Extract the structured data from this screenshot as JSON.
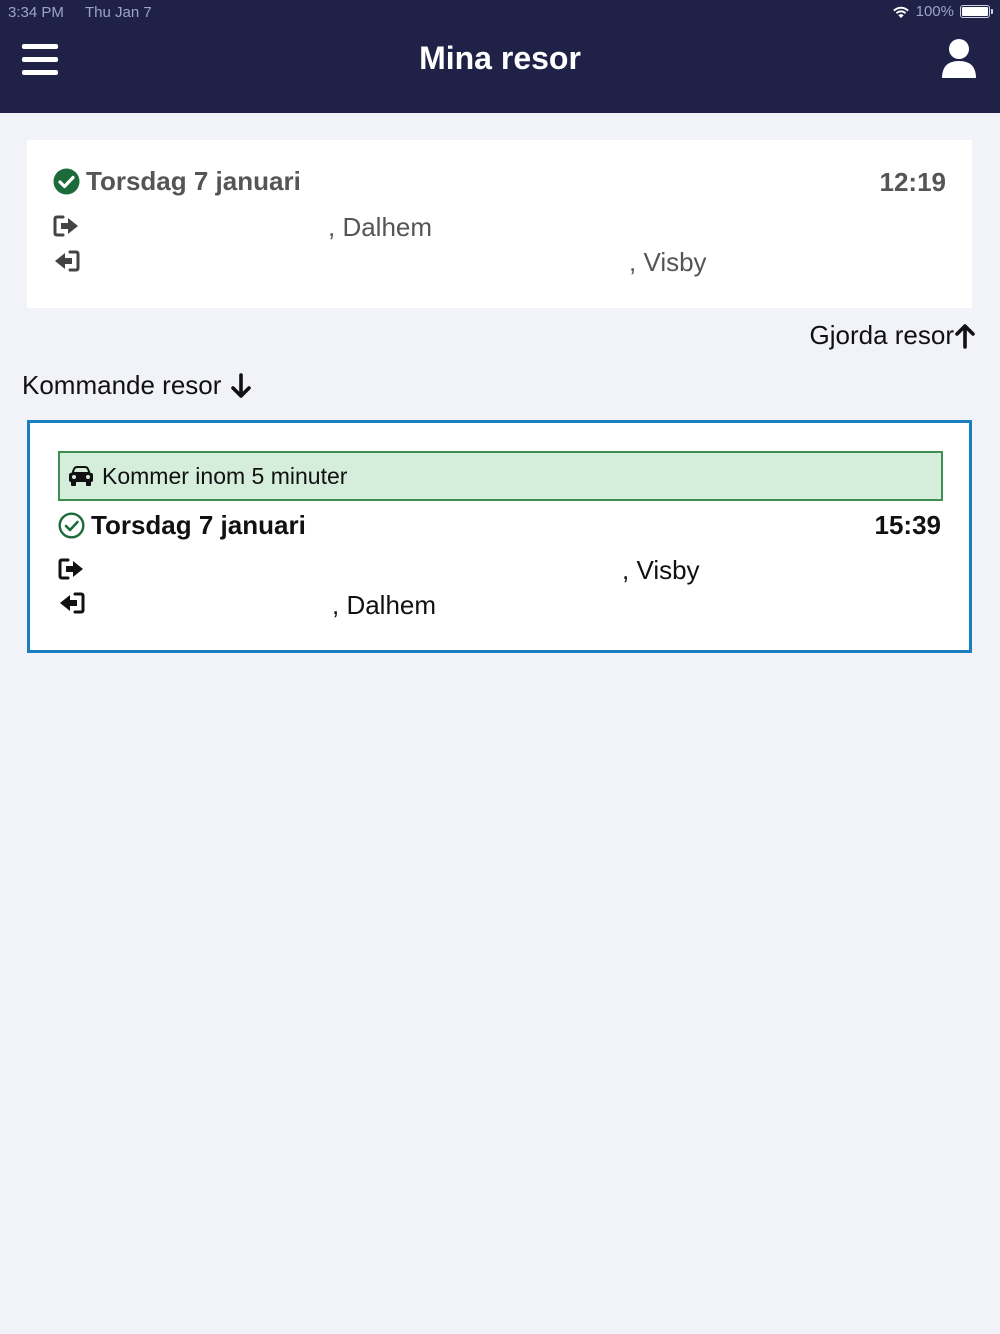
{
  "statusbar": {
    "time": "3:34 PM",
    "date": "Thu Jan 7",
    "battery": "100%"
  },
  "header": {
    "title": "Mina resor"
  },
  "past_trip": {
    "date": "Torsdag 7 januari",
    "time": "12:19",
    "from": ", Dalhem",
    "to": ", Visby"
  },
  "done_toggle": {
    "label": "Gjorda resor"
  },
  "upcoming_toggle": {
    "label": "Kommande resor"
  },
  "upcoming_trip": {
    "eta": "Kommer inom 5 minuter",
    "date": "Torsdag 7 januari",
    "time": "15:39",
    "from": ", Visby",
    "to": ", Dalhem"
  },
  "colors": {
    "header": "#1f2246",
    "background": "#f2f3f8",
    "accent_border": "#1a7dbf",
    "eta_background": "#d4eedb",
    "check_green": "#1d6b3a"
  }
}
